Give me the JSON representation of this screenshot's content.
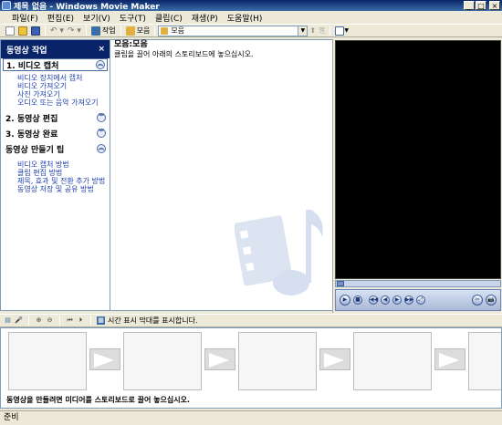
{
  "window": {
    "title": "제목 없음 - Windows Movie Maker",
    "controls": [
      "_",
      "□",
      "×"
    ]
  },
  "menu": [
    "파일(F)",
    "편집(E)",
    "보기(V)",
    "도구(T)",
    "클립(C)",
    "재생(P)",
    "도움말(H)"
  ],
  "toolbar": {
    "tasks_label": "작업",
    "collections_label": "모음",
    "location_value": "모음",
    "colors": {
      "tasks": "#3a6ea5",
      "collections": "#e0b040"
    }
  },
  "taskpane": {
    "header": "동영상 작업",
    "close": "×",
    "sections": [
      {
        "title": "1. 비디오 캡처",
        "chevron": "︽",
        "links": [
          "비디오 장치에서 캡처",
          "비디오 가져오기",
          "사진 가져오기",
          "오디오 또는 음악 가져오기"
        ]
      },
      {
        "title": "2. 동영상 편집",
        "chevron": "︾",
        "links": []
      },
      {
        "title": "3. 동영상 완료",
        "chevron": "︾",
        "links": []
      },
      {
        "title": "동영상 만들기 팁",
        "chevron": "︽",
        "links": [
          "비디오 캡처 방법",
          "클립 편집 방법",
          "제목, 효과 및 전환 추가 방법",
          "동영상 저장 및 공유 방법"
        ]
      }
    ]
  },
  "collection": {
    "title": "모음:모음",
    "hint": "클립을 끌어 아래의 스토리보드에 놓으십시오."
  },
  "preview": {
    "screen_color": "#000000",
    "buttons": [
      "▶",
      "■",
      "◀◀",
      "◀",
      "▶",
      "▶▶",
      "⤢",
      "✂",
      "📷"
    ]
  },
  "storyboard": {
    "toggle_label": "시간 표시 막대를 표시합니다.",
    "note": "동영상을 만들려면 미디어를 스토리보드로 끌어 놓으십시오."
  },
  "status": {
    "text": "준비"
  }
}
